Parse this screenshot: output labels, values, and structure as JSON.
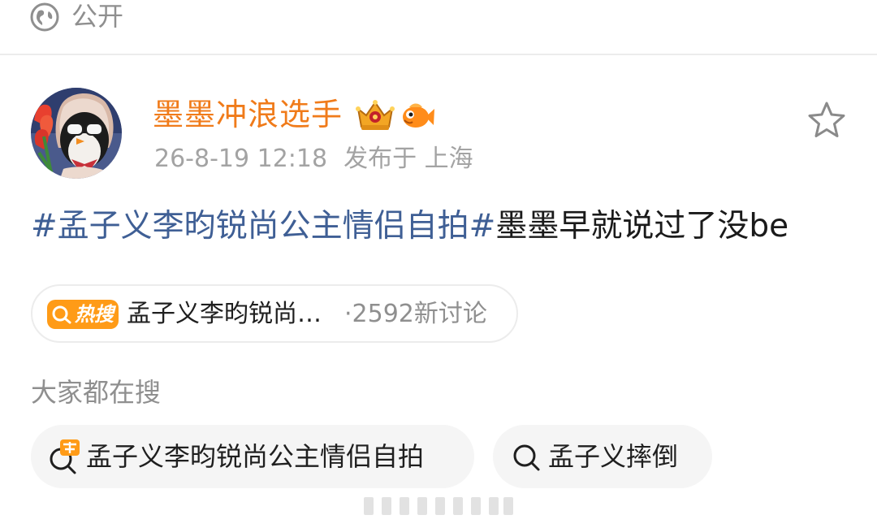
{
  "header": {
    "visibility_icon": "globe-icon",
    "visibility_label": "公开"
  },
  "post": {
    "author": {
      "name": "墨墨冲浪选手",
      "name_color": "#f07b1a",
      "avatar": "avatar-image",
      "badges": [
        "crown-badge-icon",
        "fish-badge-icon"
      ]
    },
    "timestamp": "26-8-19 12:18",
    "location": "发布于 上海",
    "text_parts": {
      "hashtag": "#孟子义李昀锐尚公主情侣自拍#",
      "body": "墨墨早就说过了没be"
    },
    "hashtag_color": "#3f5f95",
    "favorite_icon": "star-outline-icon"
  },
  "hot_search": {
    "badge_icon": "search-icon",
    "badge_label": "热搜",
    "badge_color": "#ff9b17",
    "topic": "孟子义李昀锐尚…",
    "count": "·2592新讨论"
  },
  "everyone_searching": {
    "label": "大家都在搜",
    "items": [
      {
        "icon": "hot-search-icon",
        "text": "孟子义李昀锐尚公主情侣自拍"
      },
      {
        "icon": "search-icon",
        "text": "孟子义摔倒"
      }
    ]
  }
}
